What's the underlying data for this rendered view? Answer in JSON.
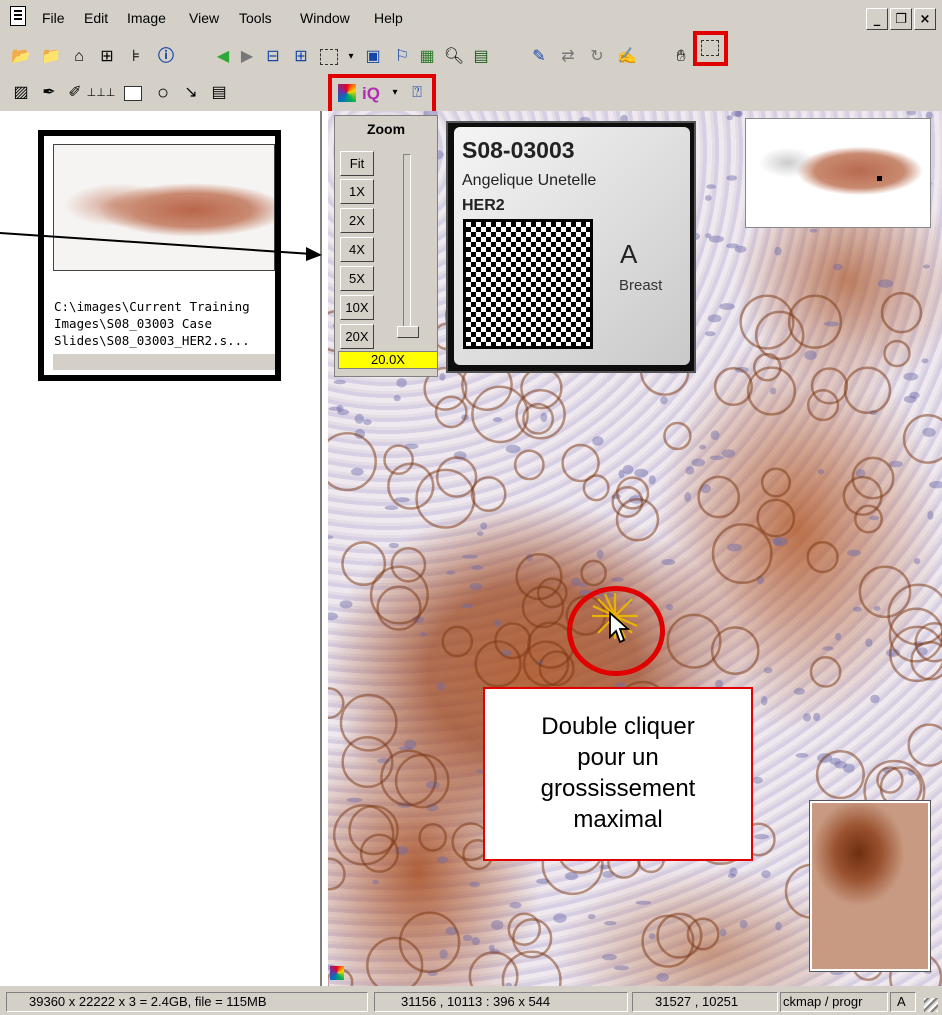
{
  "menu": [
    "File",
    "Edit",
    "Image",
    "View",
    "Tools",
    "Window",
    "Help"
  ],
  "window_controls": {
    "minimize": "_",
    "restore": "3",
    "close": "×"
  },
  "toolbar1_icons": [
    "open-folder-icon",
    "open-remote-folder-icon",
    "snapshot-camera-icon",
    "network-icon",
    "properties-icon",
    "info-icon",
    "back-arrow-icon",
    "forward-arrow-icon",
    "tile-horizontal-icon",
    "tile-vertical-icon",
    "selection-box-icon",
    "dropdown-arrow-icon",
    "window-icon",
    "flag-icon",
    "compare-icon",
    "magnifier-icon",
    "notes-icon",
    "edit-icon",
    "sync-icon",
    "rotate-icon",
    "annotate-icon",
    "hand-pan-icon",
    "region-select-icon"
  ],
  "toolbar2_icons": [
    "save-region-icon",
    "pen-tool-icon",
    "pen-scribble-icon",
    "ruler-icon",
    "rectangle-tool-icon",
    "ellipse-tool-icon",
    "arrow-tool-icon",
    "text-tool-icon",
    "color-wheel-icon",
    "image-quality-icon",
    "dropdown-arrow-icon",
    "help-icon"
  ],
  "toolbar2_text": {
    "iq": "iQ"
  },
  "thumbnail": {
    "path": "C:\\images\\Current Training Images\\S08_03003 Case Slides\\S08_03003_HER2.s..."
  },
  "zoom": {
    "title": "Zoom",
    "buttons": [
      "Fit",
      "1X",
      "2X",
      "4X",
      "5X",
      "10X",
      "20X"
    ],
    "level": "20.0X",
    "slider_fraction": 1.0
  },
  "label": {
    "id": "S08-03003",
    "name": "Angelique Unetelle",
    "stain": "HER2",
    "letter": "A",
    "tissue": "Breast"
  },
  "callout": {
    "lines": [
      "Double cliquer",
      "pour un",
      "grossissement",
      "maximal"
    ]
  },
  "status": {
    "dimensions": "39360 x 22222 x 3 = 2.4GB, file = 115MB",
    "view_region": "31156 , 10113 : 396 x 544",
    "cursor_pos": "31527 , 10251",
    "mode": "ckmap / progr",
    "flag": "A"
  },
  "colors": {
    "chrome": "#d4d0c8",
    "highlight_red": "#e00000",
    "zoom_level_bg": "#ffff00",
    "stain_brown": "#9a5230"
  }
}
